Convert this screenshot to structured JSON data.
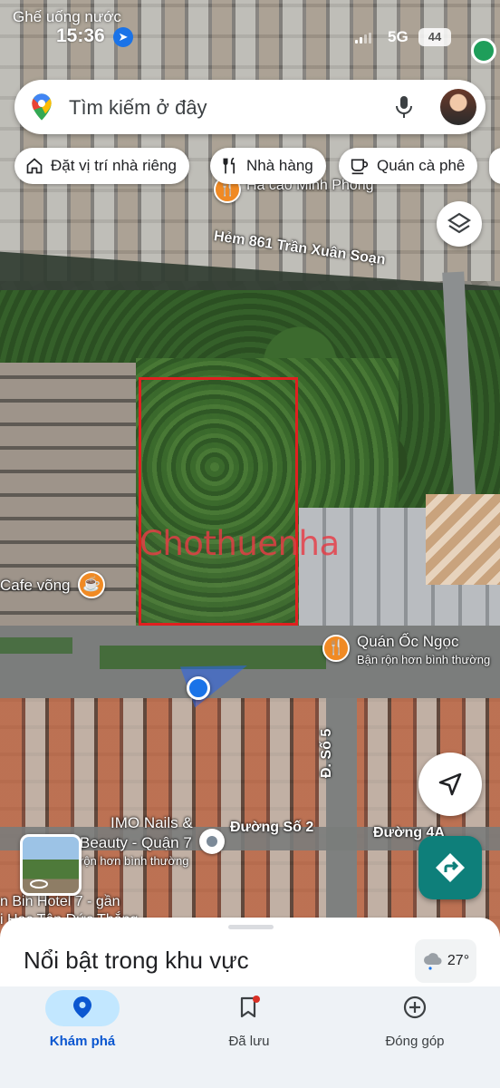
{
  "status_bar": {
    "time": "15:36",
    "network": "5G",
    "battery": "44",
    "top_label": "Ghế uống nước"
  },
  "search": {
    "placeholder": "Tìm kiếm ở đây"
  },
  "chips": [
    {
      "label": "Đặt vị trí nhà riêng",
      "icon": "home-icon"
    },
    {
      "label": "Nhà hàng",
      "icon": "fork-knife-icon"
    },
    {
      "label": "Quán cà phê",
      "icon": "coffee-icon"
    }
  ],
  "map": {
    "poi_top": "Hà cáo Minh Phong",
    "street_alley": "Hẻm 861 Trần Xuân Soạn",
    "watermark": "Chothuenha",
    "cafe": "Cafe võng",
    "restaurant": "Quán Ốc Ngọc",
    "restaurant_status": "Bận rộn hơn bình thường",
    "street_d5": "Đ. Số 5",
    "nails_line1": "IMO Nails &",
    "nails_line2": "Beauty - Quận 7",
    "nails_status": "rộn hơn bình thường",
    "street_2": "Đường Số 2",
    "street_4a": "Đường 4A",
    "hotel_line1": "n Bin Hotel 7 - gần",
    "hotel_line2": "i Học Tôn Đức Thắng"
  },
  "sheet": {
    "title": "Nổi bật trong khu vực",
    "weather_temp": "27°"
  },
  "nav": [
    {
      "label": "Khám phá",
      "icon": "pin-icon",
      "active": true
    },
    {
      "label": "Đã lưu",
      "icon": "bookmark-icon",
      "active": false
    },
    {
      "label": "Đóng góp",
      "icon": "plus-circle-icon",
      "active": false
    }
  ],
  "colors": {
    "marked_lot_border": "#e02020",
    "my_location": "#1a73e8",
    "directions_button": "#0e7f7a",
    "poi_orange": "#f08a24",
    "nav_active_pill": "#c2e7ff"
  }
}
